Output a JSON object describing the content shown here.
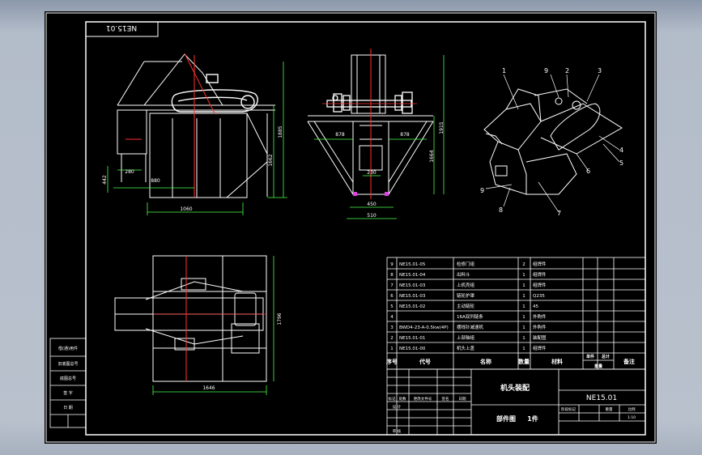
{
  "drawing": {
    "code_stamp": "NE15.01",
    "title": "机头装配",
    "code": "NE15.01",
    "caption": "部件图",
    "caption_count": "1件"
  },
  "dims": {
    "front_width": "1060",
    "front_span": "880",
    "front_left": "280",
    "front_small": "442",
    "front_height": "1662",
    "front_total": "1885",
    "side_left": "878",
    "side_right": "878",
    "side_inner": "230",
    "side_width": "450",
    "side_total": "510",
    "side_height": "1664",
    "side_total_h": "1915",
    "plan_width": "1646",
    "plan_height": "1796"
  },
  "balloons": [
    "1",
    "9",
    "2",
    "3",
    "4",
    "5",
    "6",
    "7",
    "8",
    "9"
  ],
  "bom": {
    "rows": [
      {
        "no": "9",
        "code": "NE15.01-05",
        "name": "检修门组",
        "qty": "2",
        "mat": "组焊件"
      },
      {
        "no": "8",
        "code": "NE15.01-04",
        "name": "出料斗",
        "qty": "1",
        "mat": "组焊件"
      },
      {
        "no": "7",
        "code": "NE15.01-03",
        "name": "上机壳组",
        "qty": "1",
        "mat": "组焊件"
      },
      {
        "no": "6",
        "code": "NE15.01-03",
        "name": "链轮护罩",
        "qty": "1",
        "mat": "Q235"
      },
      {
        "no": "5",
        "code": "NE15.01-02",
        "name": "主动链轮",
        "qty": "1",
        "mat": "45"
      },
      {
        "no": "4",
        "code": "",
        "name": "16A双列链条",
        "qty": "1",
        "mat": "外购件"
      },
      {
        "no": "3",
        "code": "BWD4-23-A-0.5kw(4P)",
        "name": "摆线针减速机",
        "qty": "1",
        "mat": "外购件"
      },
      {
        "no": "2",
        "code": "NE15.01-01",
        "name": "上部轴组",
        "qty": "1",
        "mat": "装配图"
      },
      {
        "no": "1",
        "code": "NE15.01-00",
        "name": "机头上盖",
        "qty": "1",
        "mat": "组焊件"
      }
    ],
    "headers": {
      "no": "序号",
      "code": "代号",
      "name": "名称",
      "qty": "数量",
      "mat": "材料",
      "unit": "单件",
      "total": "总计",
      "weight": "重量",
      "remark": "备注"
    }
  },
  "left_strip": [
    "借(通)用件",
    "旧底图总号",
    "底图总号",
    "签  字",
    "日  期"
  ],
  "title_labels": [
    "标记",
    "处数",
    "更改文件号",
    "签名",
    "日期",
    "设 计",
    "审 核",
    "阶段标记",
    "重量",
    "比例"
  ],
  "scale": "1:10"
}
